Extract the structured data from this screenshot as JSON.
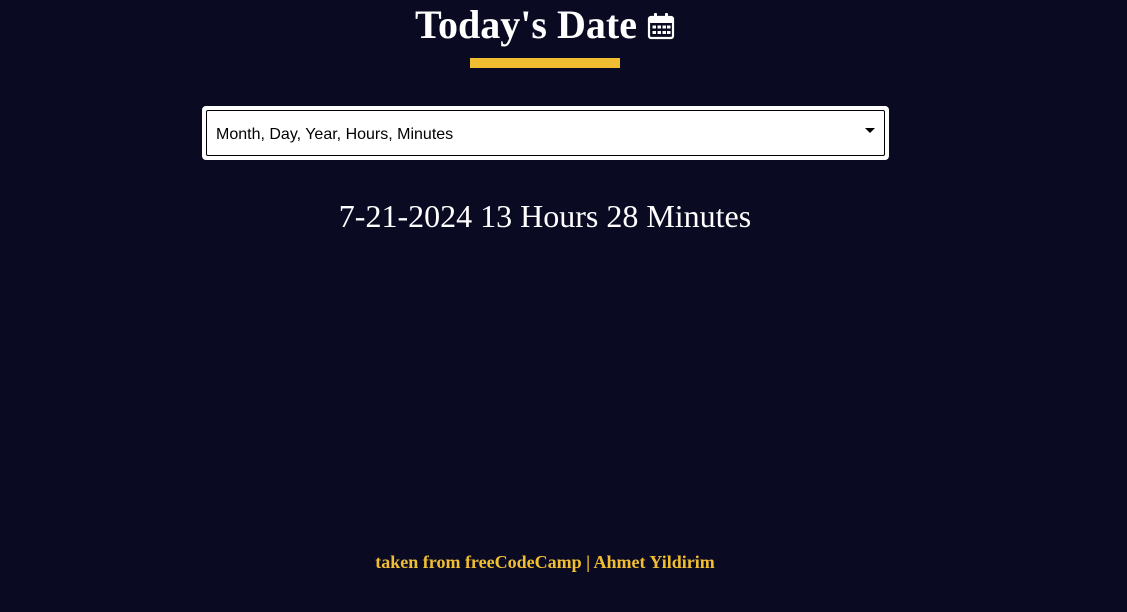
{
  "header": {
    "title": "Today's Date",
    "icon": "calendar-icon"
  },
  "date_format_select": {
    "selected": "Month, Day, Year, Hours, Minutes",
    "icon": "chevron-down-icon"
  },
  "date_output": {
    "text": "7-21-2024 13 Hours 28 Minutes"
  },
  "footer": {
    "text": "taken from freeCodeCamp | Ahmet Yildirim"
  },
  "colors": {
    "background": "#0a0a23",
    "accent": "#f1be32",
    "text": "#ffffff"
  }
}
